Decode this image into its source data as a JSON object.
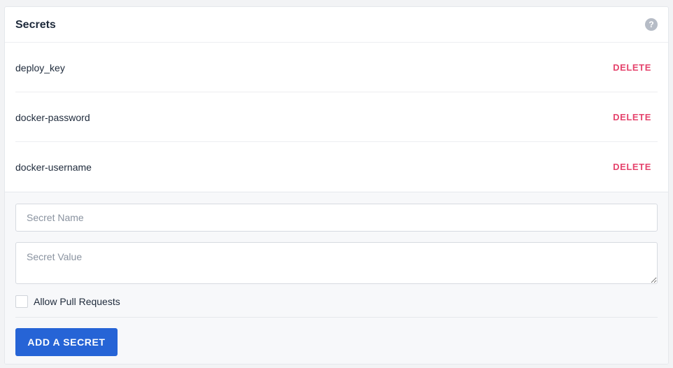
{
  "header": {
    "title": "Secrets",
    "help_icon": "question-mark-icon",
    "help_glyph": "?"
  },
  "secrets": [
    {
      "name": "deploy_key",
      "action": "DELETE"
    },
    {
      "name": "docker-password",
      "action": "DELETE"
    },
    {
      "name": "docker-username",
      "action": "DELETE"
    }
  ],
  "form": {
    "name_placeholder": "Secret Name",
    "name_value": "",
    "value_placeholder": "Secret Value",
    "value_value": "",
    "allow_pull_requests_label": "Allow Pull Requests",
    "allow_pull_requests_checked": false,
    "submit_label": "ADD A SECRET"
  },
  "colors": {
    "delete": "#e5446d",
    "primary": "#2664d6",
    "help_icon": "#b6bcc6"
  }
}
